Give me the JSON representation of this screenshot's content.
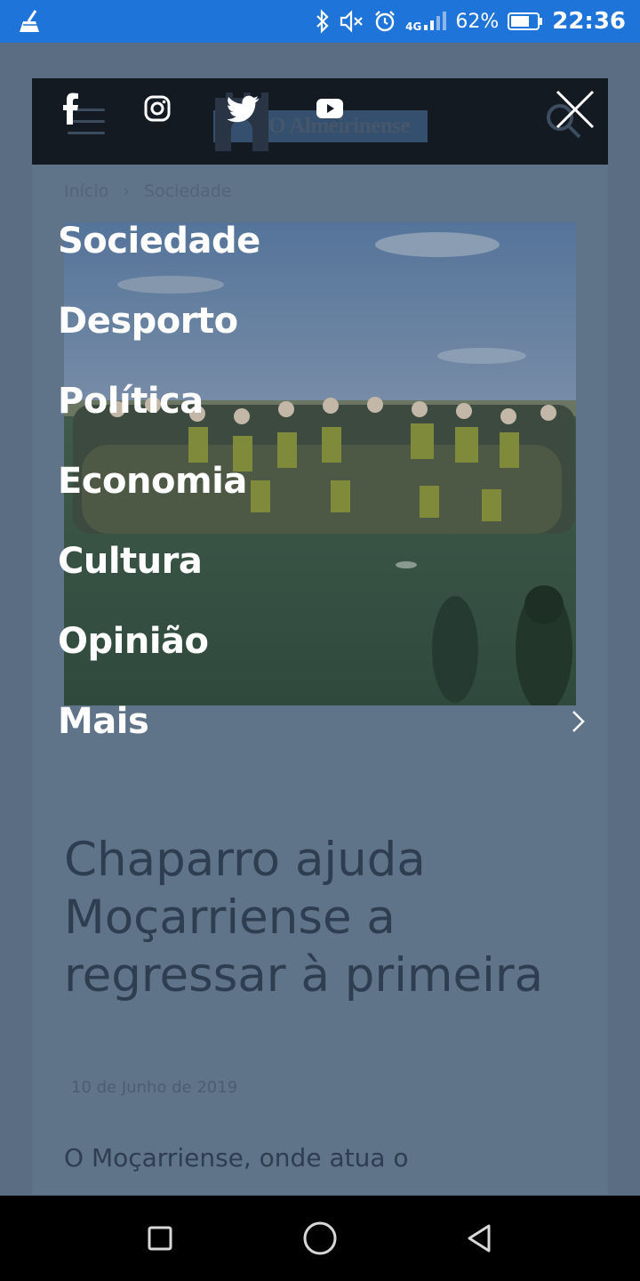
{
  "status_bar": {
    "network": "4G",
    "battery_percent": "62%",
    "time": "22:36",
    "icons": [
      "cleaner-icon",
      "bluetooth-icon",
      "mute-icon",
      "alarm-icon",
      "signal-icon",
      "battery-icon"
    ],
    "background_color": "#1e74d8"
  },
  "site": {
    "logo_text": "O Almeirinense",
    "breadcrumb": {
      "home": "Início",
      "separator": "›",
      "current": "Sociedade"
    }
  },
  "article": {
    "title": "Chaparro ajuda Moçarriense a regressar à primeira",
    "date": "10 de Junho de 2019",
    "lead": "O Moçarriense, onde atua o"
  },
  "overlay": {
    "social_icons": [
      "facebook-icon",
      "instagram-icon",
      "twitter-icon",
      "youtube-icon"
    ],
    "menu": [
      {
        "label": "Sociedade"
      },
      {
        "label": "Desporto"
      },
      {
        "label": "Política"
      },
      {
        "label": "Economia"
      },
      {
        "label": "Cultura"
      },
      {
        "label": "Opinião"
      },
      {
        "label": "Mais",
        "has_submenu": true
      }
    ]
  },
  "nav_bar": {
    "buttons": [
      "recents-button",
      "home-button",
      "back-button"
    ]
  }
}
